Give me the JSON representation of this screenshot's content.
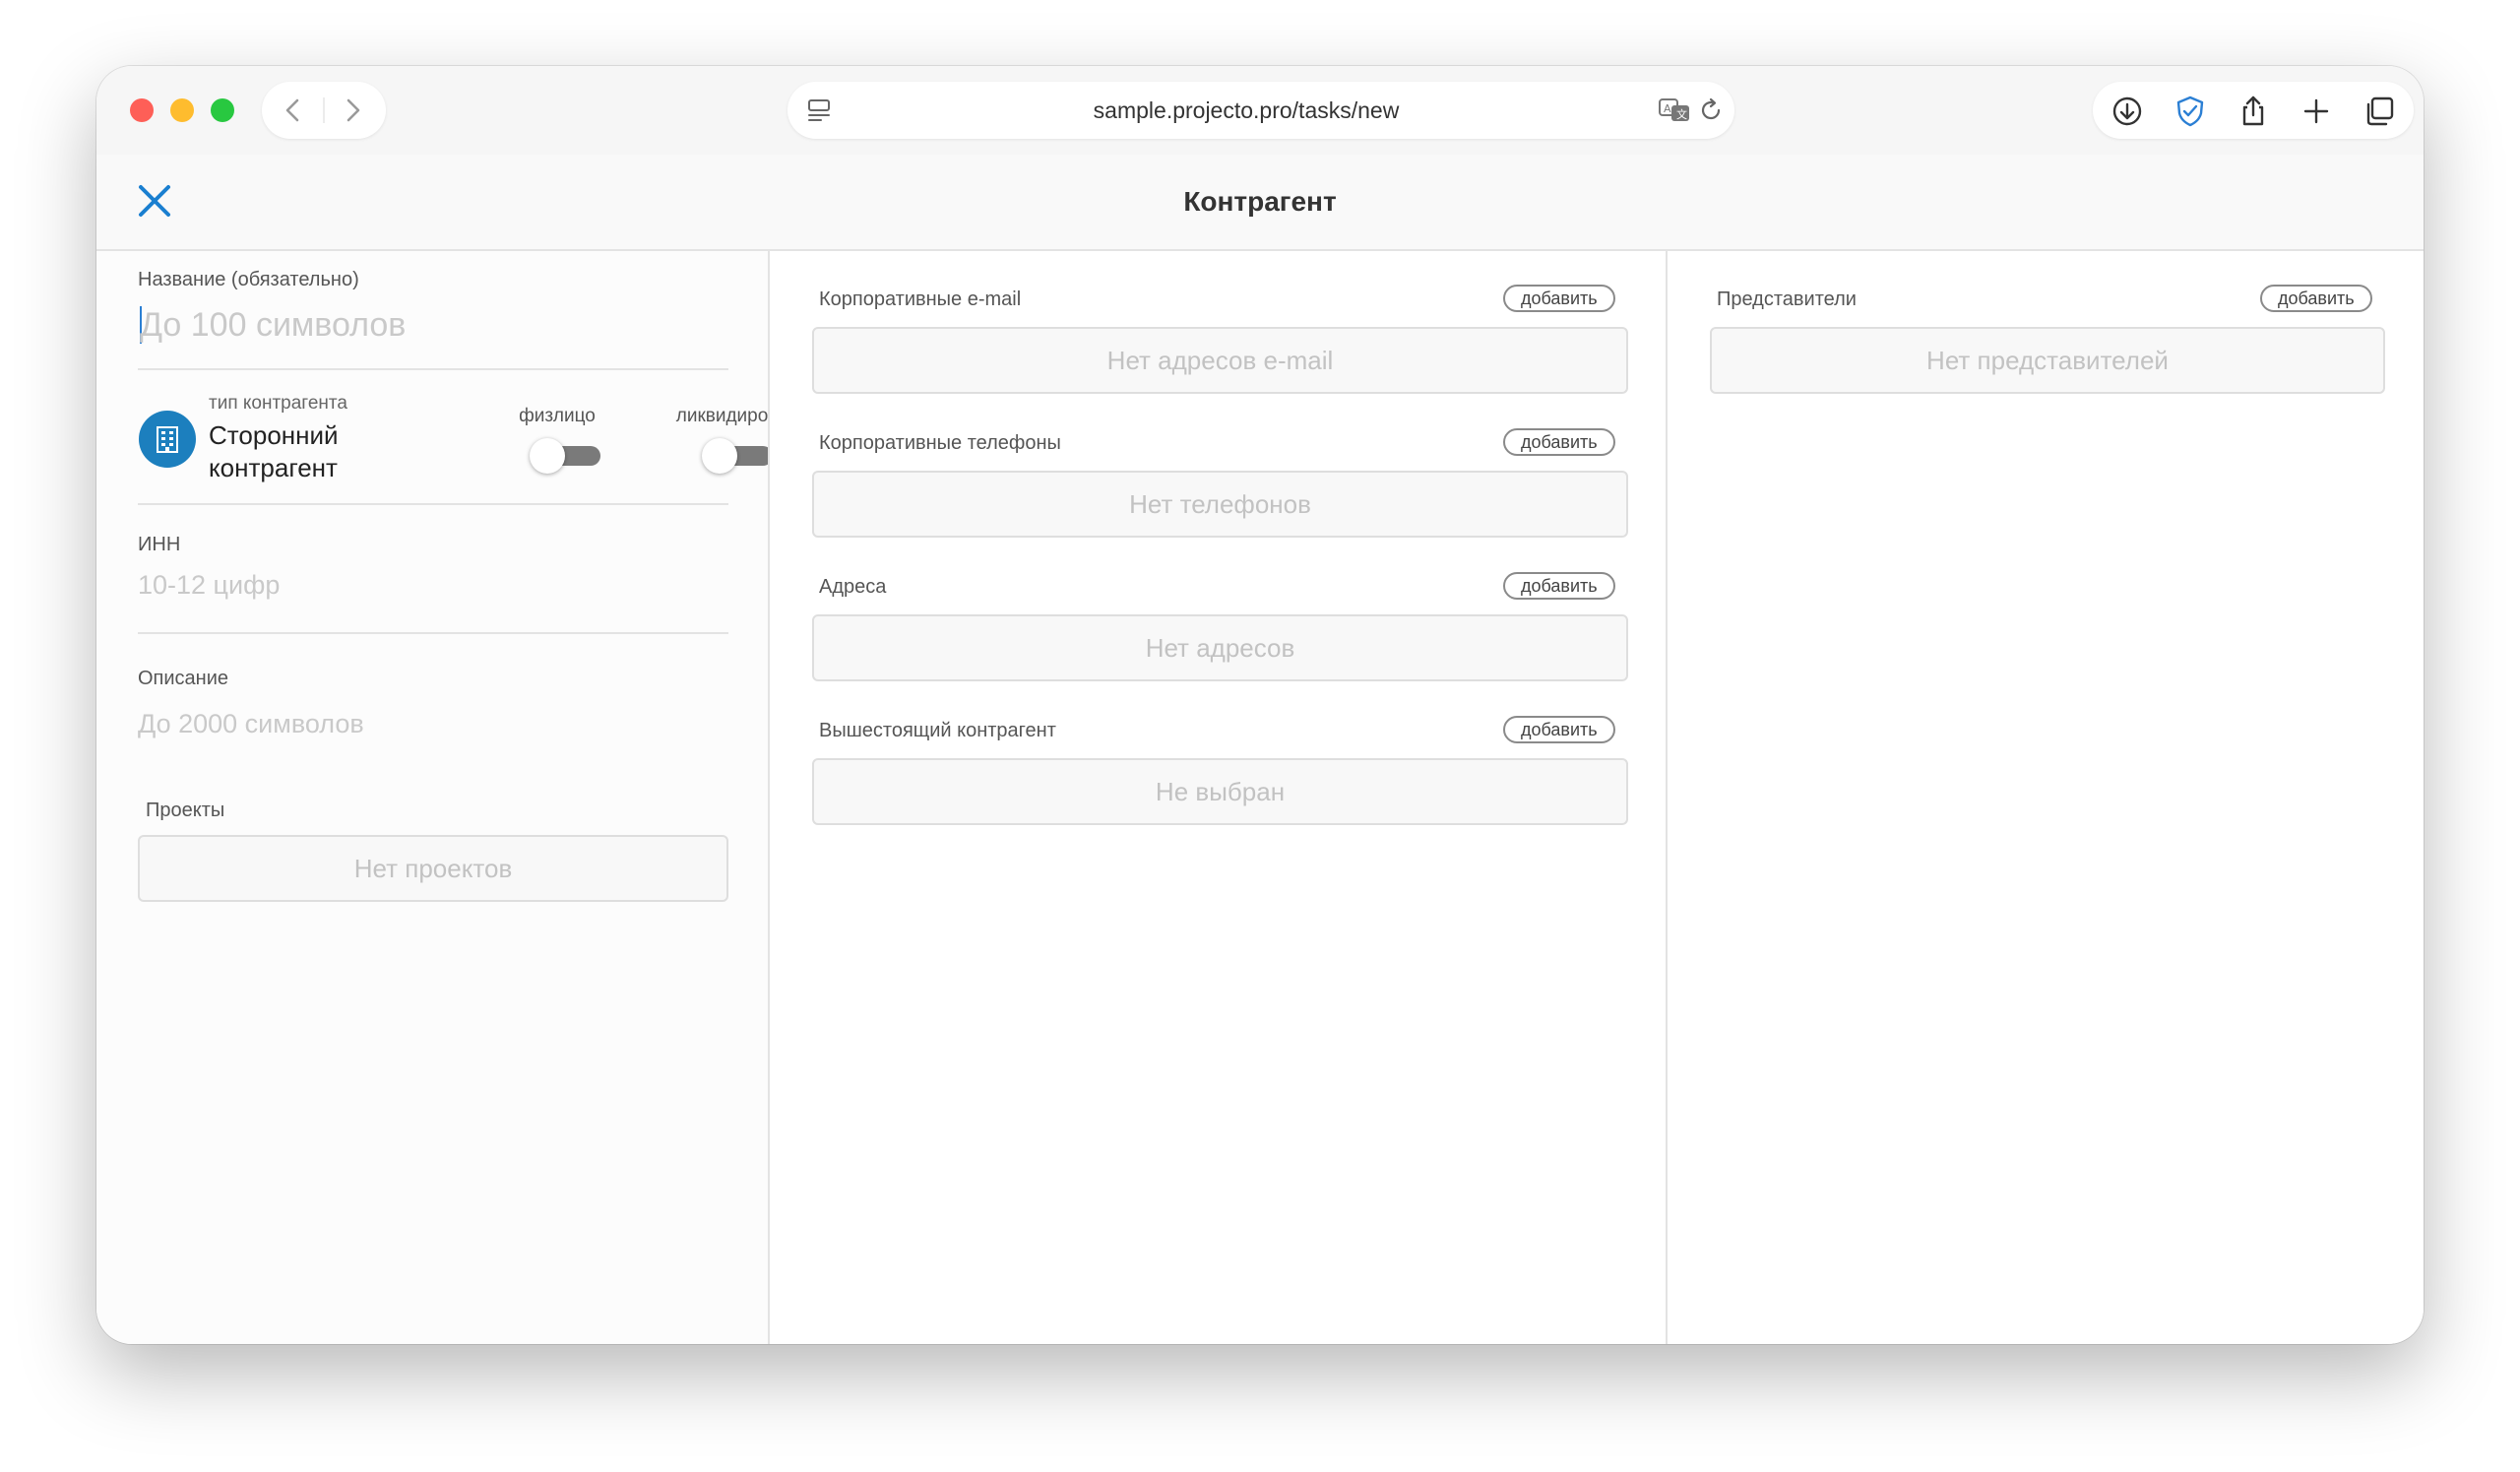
{
  "browser": {
    "url": "sample.projecto.pro/tasks/new",
    "icons": [
      "sidebar-icon",
      "back-icon",
      "forward-icon",
      "reader-icon",
      "translate-icon",
      "reload-icon",
      "download-icon",
      "shield-icon",
      "share-icon",
      "new-tab-icon",
      "tabs-icon"
    ]
  },
  "header": {
    "title": "Контрагент"
  },
  "left": {
    "name_label": "Название (обязательно)",
    "name_placeholder": "До 100 символов",
    "type_small_label": "тип контрагента",
    "type_value": "Сторонний контрагент",
    "switch_individual": {
      "label": "физлицо",
      "on": false
    },
    "switch_liquidated": {
      "label": "ликвидирован",
      "on": false
    },
    "inn_label": "ИНН",
    "inn_placeholder": "10-12 цифр",
    "description_label": "Описание",
    "description_placeholder": "До 2000 символов",
    "projects_label": "Проекты",
    "projects_empty": "Нет проектов"
  },
  "middle": {
    "sections": [
      {
        "label": "Корпоративные e-mail",
        "add": "добавить",
        "empty": "Нет адресов e-mail"
      },
      {
        "label": "Корпоративные телефоны",
        "add": "добавить",
        "empty": "Нет телефонов"
      },
      {
        "label": "Адреса",
        "add": "добавить",
        "empty": "Нет адресов"
      },
      {
        "label": "Вышестоящий контрагент",
        "add": "добавить",
        "empty": "Не выбран"
      }
    ]
  },
  "right": {
    "representatives_label": "Представители",
    "add": "добавить",
    "representatives_empty": "Нет представителей"
  },
  "colors": {
    "accent": "#1c7fbe",
    "close_icon": "#1a7fd0",
    "traffic_red": "#fe5f57",
    "traffic_yellow": "#febc2e",
    "traffic_green": "#28c840"
  }
}
